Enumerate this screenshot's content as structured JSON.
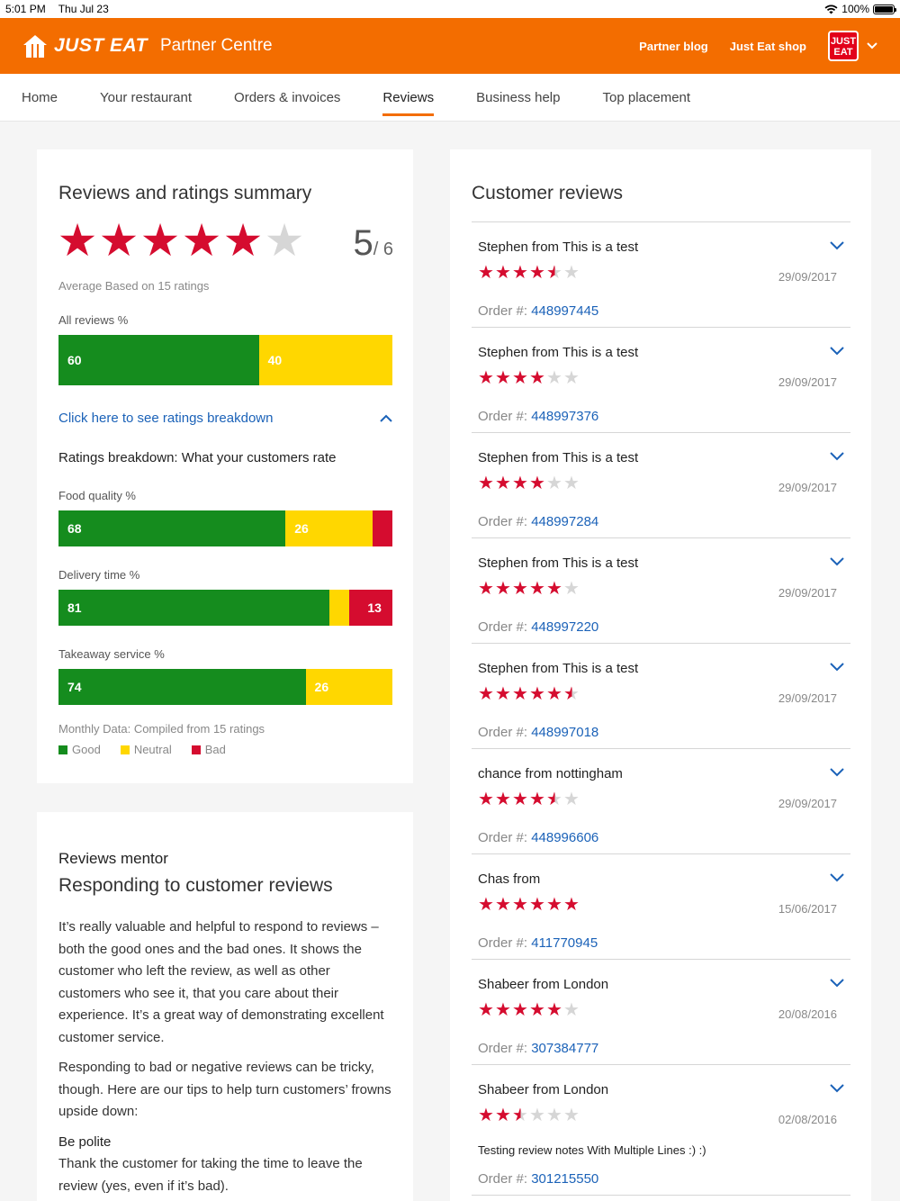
{
  "status_bar": {
    "time": "5:01 PM",
    "date": "Thu Jul 23",
    "battery": "100%"
  },
  "header": {
    "logo": "JUST EAT",
    "subtitle": "Partner Centre",
    "links": [
      "Partner blog",
      "Just Eat shop"
    ],
    "badge_line1": "JUST",
    "badge_line2": "EAT"
  },
  "nav": {
    "tabs": [
      {
        "label": "Home",
        "active": false
      },
      {
        "label": "Your restaurant",
        "active": false
      },
      {
        "label": "Orders & invoices",
        "active": false
      },
      {
        "label": "Reviews",
        "active": true
      },
      {
        "label": "Business help",
        "active": false
      },
      {
        "label": "Top placement",
        "active": false
      }
    ]
  },
  "summary": {
    "title": "Reviews and ratings summary",
    "stars_filled": 5,
    "stars_total": 6,
    "score": "5",
    "score_total": "/ 6",
    "average_text": "Average Based on 15 ratings",
    "all_reviews_label": "All reviews %",
    "all_reviews": {
      "good": 60,
      "neutral": 40,
      "bad": 0
    },
    "breakdown_link": "Click here to see ratings breakdown",
    "breakdown_title": "Ratings breakdown: What your customers rate",
    "categories": [
      {
        "label": "Food quality %",
        "good": 68,
        "neutral": 26,
        "bad": 6,
        "good_label": "68",
        "neutral_label": "26",
        "bad_label": ""
      },
      {
        "label": "Delivery time %",
        "good": 81,
        "neutral": 6,
        "bad": 13,
        "good_label": "81",
        "neutral_label": "",
        "bad_label": "13"
      },
      {
        "label": "Takeaway service %",
        "good": 74,
        "neutral": 26,
        "bad": 0,
        "good_label": "74",
        "neutral_label": "26",
        "bad_label": ""
      }
    ],
    "monthly_text": "Monthly Data: Compiled from 15 ratings",
    "legend": {
      "good": "Good",
      "neutral": "Neutral",
      "bad": "Bad"
    },
    "colors": {
      "good": "#158c1e",
      "neutral": "#ffd700",
      "bad": "#d50c2f"
    }
  },
  "mentor": {
    "kicker": "Reviews mentor",
    "title": "Responding to customer reviews",
    "p1": "It’s really valuable and helpful to respond to reviews – both the good ones and the bad ones. It shows the customer who left the review, as well as other customers who see it, that you care about their experience. It’s a great way of demonstrating excellent customer service.",
    "p2": "Responding to bad or negative reviews can be tricky, though. Here are our tips to help turn customers’ frowns upside down:",
    "tip_title": "Be polite",
    "tip_text": "Thank the customer for taking the time to leave the review (yes, even if it’s bad)."
  },
  "reviews": {
    "title": "Customer reviews",
    "order_label": "Order #:",
    "items": [
      {
        "name": "Stephen from This is a test",
        "rating": 4.5,
        "date": "29/09/2017",
        "order": "448997445",
        "note": ""
      },
      {
        "name": "Stephen from This is a test",
        "rating": 4,
        "date": "29/09/2017",
        "order": "448997376",
        "note": ""
      },
      {
        "name": "Stephen from This is a test",
        "rating": 4,
        "date": "29/09/2017",
        "order": "448997284",
        "note": ""
      },
      {
        "name": "Stephen from This is a test",
        "rating": 5,
        "date": "29/09/2017",
        "order": "448997220",
        "note": ""
      },
      {
        "name": "Stephen from This is a test",
        "rating": 5.5,
        "date": "29/09/2017",
        "order": "448997018",
        "note": ""
      },
      {
        "name": "chance from nottingham",
        "rating": 4.5,
        "date": "29/09/2017",
        "order": "448996606",
        "note": ""
      },
      {
        "name": "Chas from",
        "rating": 6,
        "date": "15/06/2017",
        "order": "411770945",
        "note": ""
      },
      {
        "name": "Shabeer from London",
        "rating": 5,
        "date": "20/08/2016",
        "order": "307384777",
        "note": ""
      },
      {
        "name": "Shabeer from London",
        "rating": 2.5,
        "date": "02/08/2016",
        "order": "301215550",
        "note": "Testing review notes With Multiple Lines :) :)"
      }
    ]
  }
}
